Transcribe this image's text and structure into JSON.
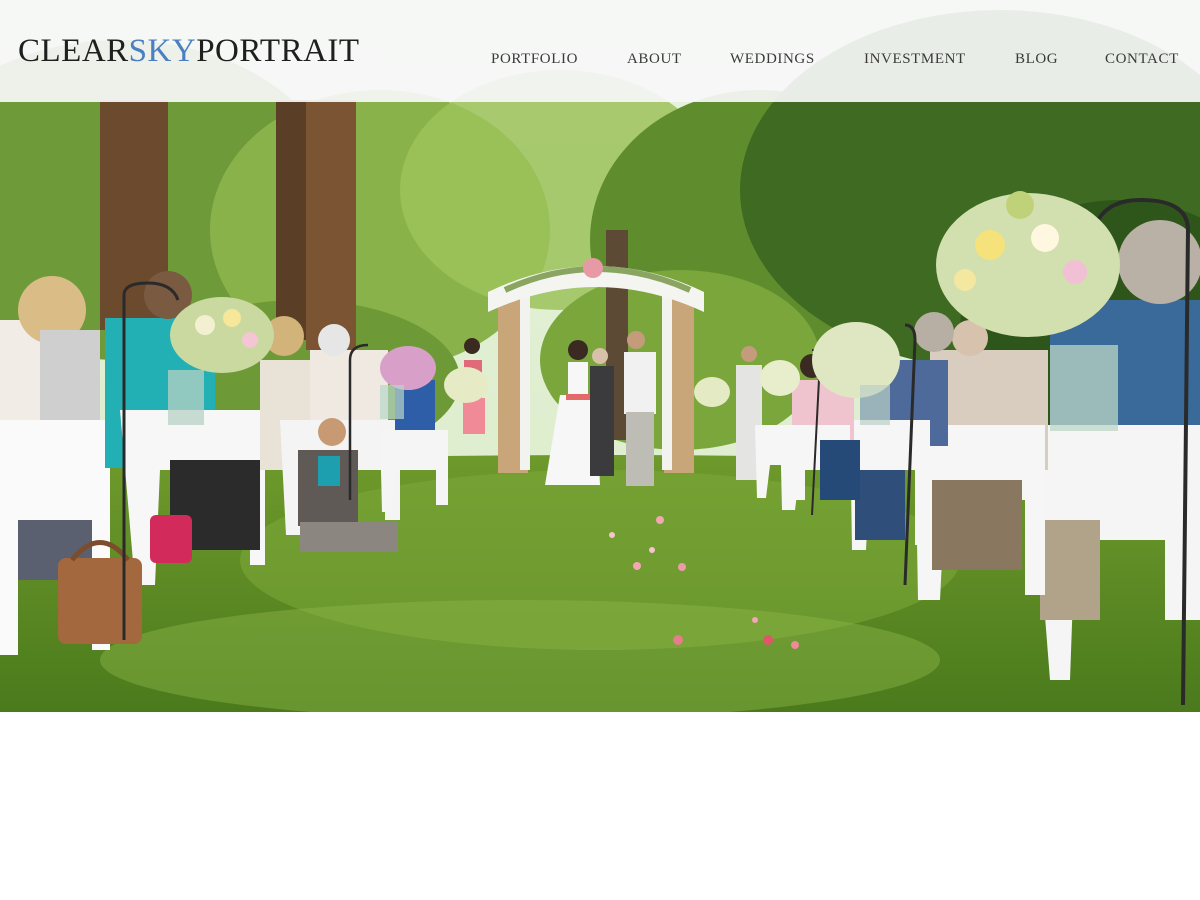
{
  "header": {
    "logo": {
      "part1": "CLEAR",
      "part2": "SKY",
      "part3": "PORTRAIT"
    },
    "nav": [
      {
        "label": "PORTFOLIO"
      },
      {
        "label": "ABOUT"
      },
      {
        "label": "WEDDINGS"
      },
      {
        "label": "INVESTMENT"
      },
      {
        "label": "BLOG"
      },
      {
        "label": "CONTACT"
      }
    ]
  },
  "hero": {
    "image": "outdoor-wedding-ceremony-photo"
  },
  "colors": {
    "header_bg": "#f6f7f7",
    "logo_text": "#1f1f1f",
    "logo_accent": "#4a7fc1",
    "nav_text": "#3a3a3a",
    "page_bg": "#ffffff"
  }
}
